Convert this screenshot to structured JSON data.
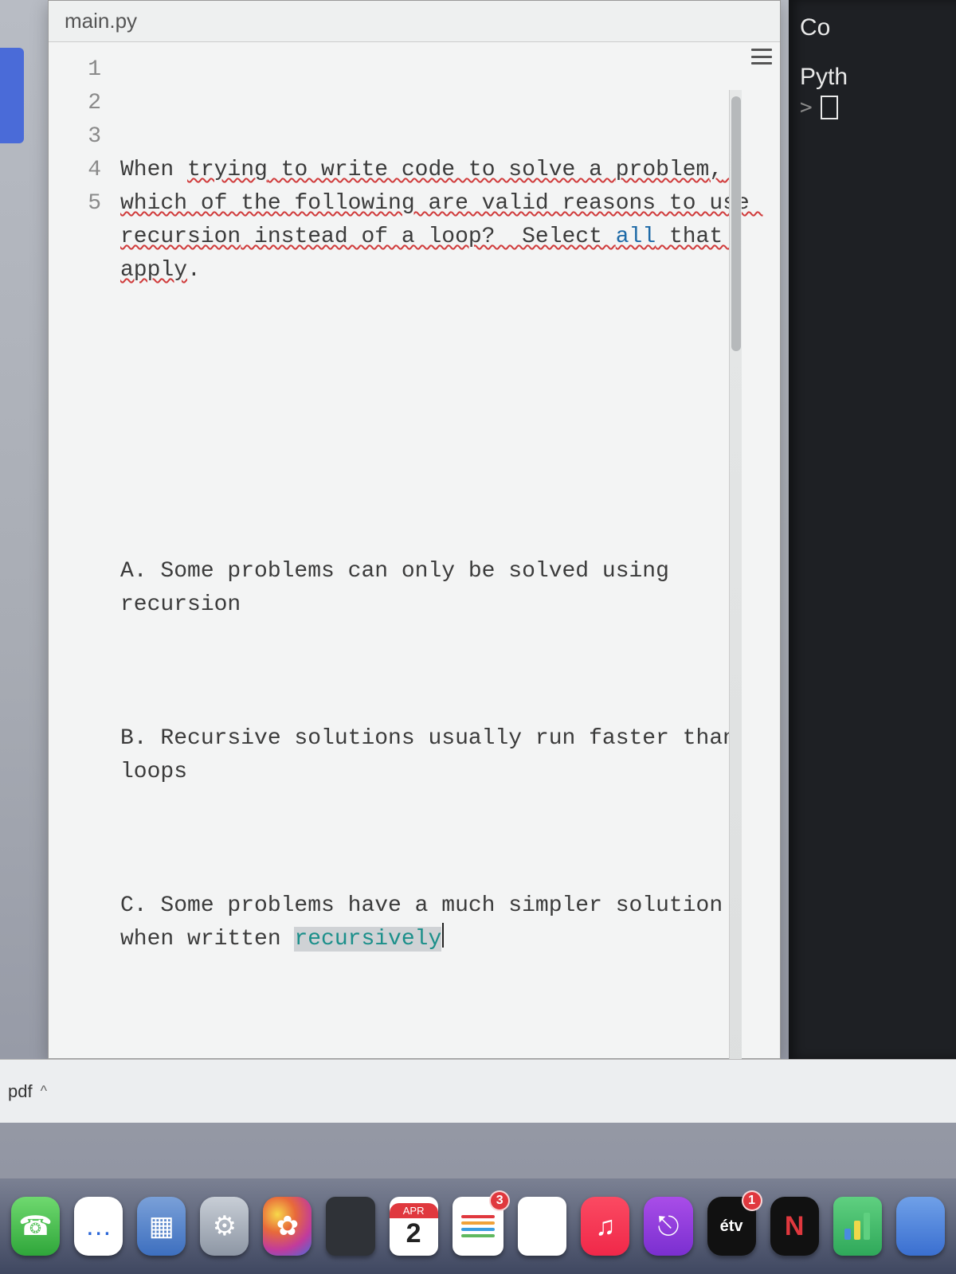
{
  "editor": {
    "filename": "main.py",
    "gutter": [
      "1",
      "2",
      "3",
      "4",
      "5"
    ],
    "line1_plain_parts": [
      "When ",
      "trying",
      " to write code to solve a ",
      "problem",
      ", which of the following are valid reasons to use ",
      "recursion",
      " instead of a loop?  Select ",
      "all",
      " that ",
      "apply",
      "."
    ],
    "line3": "A. Some problems can only be solved using recursion",
    "line4": "B. Recursive solutions usually run faster than loops",
    "line5_prefix": "C. Some problems have a much simpler solution when written ",
    "line5_word": "recursively"
  },
  "console": {
    "title_line1": "Co",
    "title_line2": "Pyth",
    "prompt": ">"
  },
  "downloads": {
    "item": "pdf"
  },
  "dock": {
    "calendar_month": "APR",
    "calendar_day": "2",
    "reminders_badge": "3",
    "tv_label": "étv",
    "tv_badge": "1",
    "netflix_label": "N"
  }
}
